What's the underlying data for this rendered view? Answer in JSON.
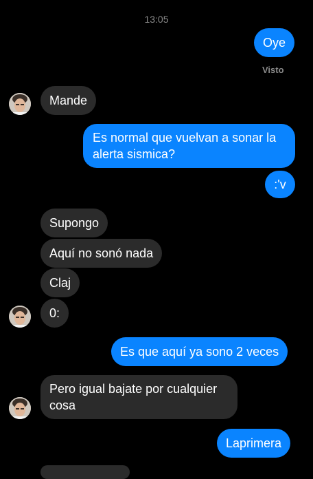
{
  "header": {
    "time": "13:05"
  },
  "status": {
    "seen": "Visto"
  },
  "messages": [
    {
      "from": "me",
      "text": "Oye"
    },
    {
      "from": "them",
      "text": "Mande"
    },
    {
      "from": "me",
      "text": "Es normal que vuelvan a sonar la alerta sismica?"
    },
    {
      "from": "me",
      "text": ":'v"
    },
    {
      "from": "them",
      "text": "Supongo"
    },
    {
      "from": "them",
      "text": "Aquí no sonó nada"
    },
    {
      "from": "them",
      "text": "Claj"
    },
    {
      "from": "them",
      "text": "0:"
    },
    {
      "from": "me",
      "text": "Es que aquí ya sono 2 veces"
    },
    {
      "from": "them",
      "text": "Pero igual bajate por cualquier cosa"
    },
    {
      "from": "me",
      "text": "Laprimera"
    }
  ],
  "colors": {
    "outgoing_bubble": "#0a84ff",
    "incoming_bubble": "#2b2b2b",
    "background": "#000000",
    "muted_text": "#8a8a8a"
  }
}
